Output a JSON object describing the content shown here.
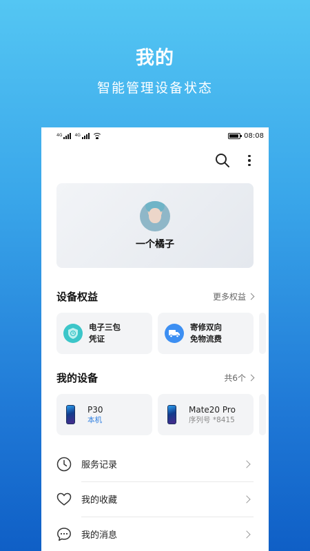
{
  "promo": {
    "title": "我的",
    "subtitle": "智能管理设备状态"
  },
  "status_bar": {
    "sim1": "4G",
    "sim2": "4G",
    "time": "08:08",
    "battery_level": 0.95
  },
  "toolbar": {
    "icons": [
      "search-icon",
      "more-vertical-icon"
    ]
  },
  "profile": {
    "name": "一个橘子"
  },
  "benefits": {
    "title": "设备权益",
    "link": "更多权益",
    "items": [
      {
        "line1": "电子三包",
        "line2": "凭证",
        "icon": "shield-clock-icon",
        "color": "#3cc6c9"
      },
      {
        "line1": "寄修双向",
        "line2": "免物流费",
        "icon": "delivery-truck-icon",
        "color": "#3d8ff2"
      }
    ]
  },
  "devices": {
    "title": "我的设备",
    "link": "共6个",
    "items": [
      {
        "name": "P30",
        "sub": "本机",
        "sub_color": "#2f7fe0"
      },
      {
        "name": "Mate20 Pro",
        "sub": "序列号 *8415",
        "sub_color": "#888888"
      }
    ]
  },
  "menu": {
    "items": [
      {
        "label": "服务记录",
        "icon": "clock-icon"
      },
      {
        "label": "我的收藏",
        "icon": "heart-icon"
      },
      {
        "label": "我的消息",
        "icon": "message-icon"
      }
    ]
  }
}
